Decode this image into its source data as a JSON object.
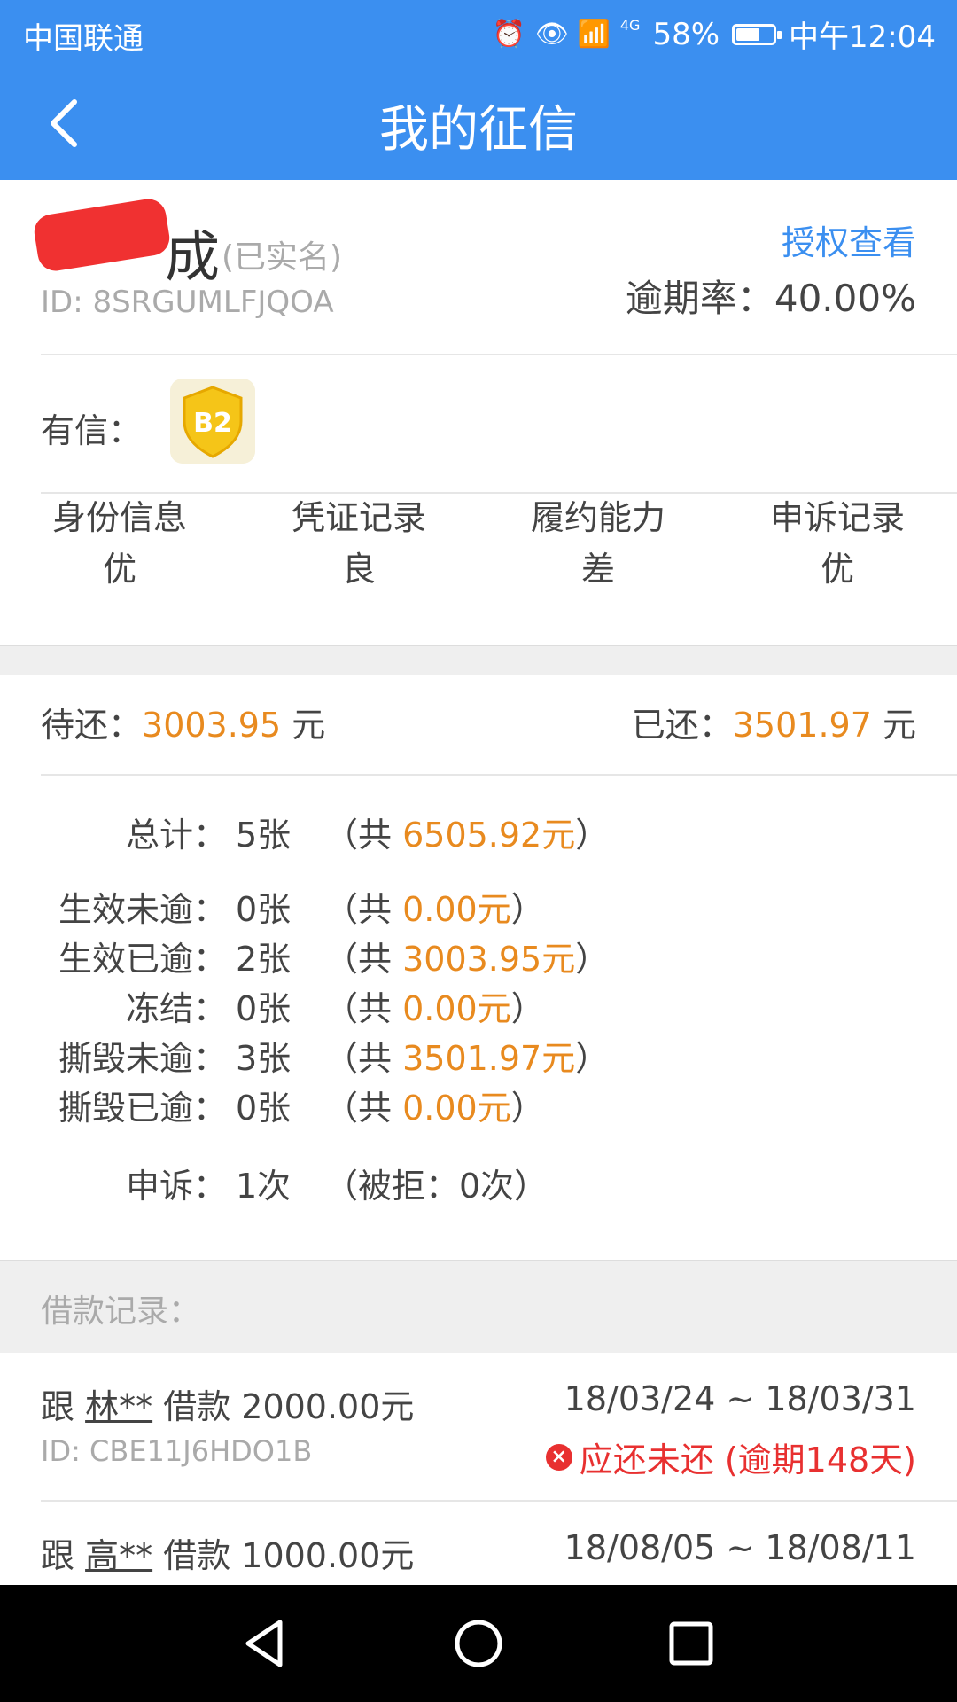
{
  "status_bar": {
    "carrier": "中国联通",
    "network": "4G",
    "battery": "58%",
    "time": "中午12:04"
  },
  "nav": {
    "title": "我的征信"
  },
  "profile": {
    "name_visible": "成",
    "verified": "(已实名)",
    "id": "ID: 8SRGUMLFJQOA",
    "auth_link": "授权查看",
    "overdue_rate": "逾期率：40.00%",
    "youxin_label": "有信：",
    "badge": "B2",
    "grades": [
      {
        "label": "身份信息",
        "value": "优"
      },
      {
        "label": "凭证记录",
        "value": "良"
      },
      {
        "label": "履约能力",
        "value": "差"
      },
      {
        "label": "申诉记录",
        "value": "优"
      }
    ]
  },
  "summary": {
    "pending_label": "待还：",
    "pending_amount": "3003.95",
    "paid_label": "已还：",
    "paid_amount": "3501.97",
    "unit": "元",
    "stats": [
      {
        "label": "总计：",
        "count": "5张",
        "prefix": "（共 ",
        "amount": "6505.92元",
        "suffix": "）"
      },
      {
        "label": "生效未逾：",
        "count": "0张",
        "prefix": "（共 ",
        "amount": "0.00元",
        "suffix": "）"
      },
      {
        "label": "生效已逾：",
        "count": "2张",
        "prefix": "（共 ",
        "amount": "3003.95元",
        "suffix": "）"
      },
      {
        "label": "冻结：",
        "count": "0张",
        "prefix": "（共 ",
        "amount": "0.00元",
        "suffix": "）"
      },
      {
        "label": "撕毁未逾：",
        "count": "3张",
        "prefix": "（共 ",
        "amount": "3501.97元",
        "suffix": "）"
      },
      {
        "label": "撕毁已逾：",
        "count": "0张",
        "prefix": "（共 ",
        "amount": "0.00元",
        "suffix": "）"
      }
    ],
    "appeal": {
      "label": "申诉：",
      "count": "1次",
      "detail": "（被拒：0次）"
    }
  },
  "loans_header": "借款记录：",
  "loans": [
    {
      "prefix": "跟 ",
      "user": "林**",
      "amount_text": " 借款 2000.00元",
      "id": "ID: CBE11J6HDO1B",
      "dates": "18/03/24 ~ 18/03/31",
      "status": "应还未还 (逾期148天)"
    },
    {
      "prefix": "跟 ",
      "user": "高**",
      "amount_text": " 借款 1000.00元",
      "id": "",
      "dates": "18/08/05 ~ 18/08/11",
      "status": ""
    }
  ],
  "colors": {
    "primary": "#3b8ff0",
    "accent_orange": "#e88a1f",
    "danger_red": "#e83030",
    "badge_yellow": "#f5c518"
  }
}
